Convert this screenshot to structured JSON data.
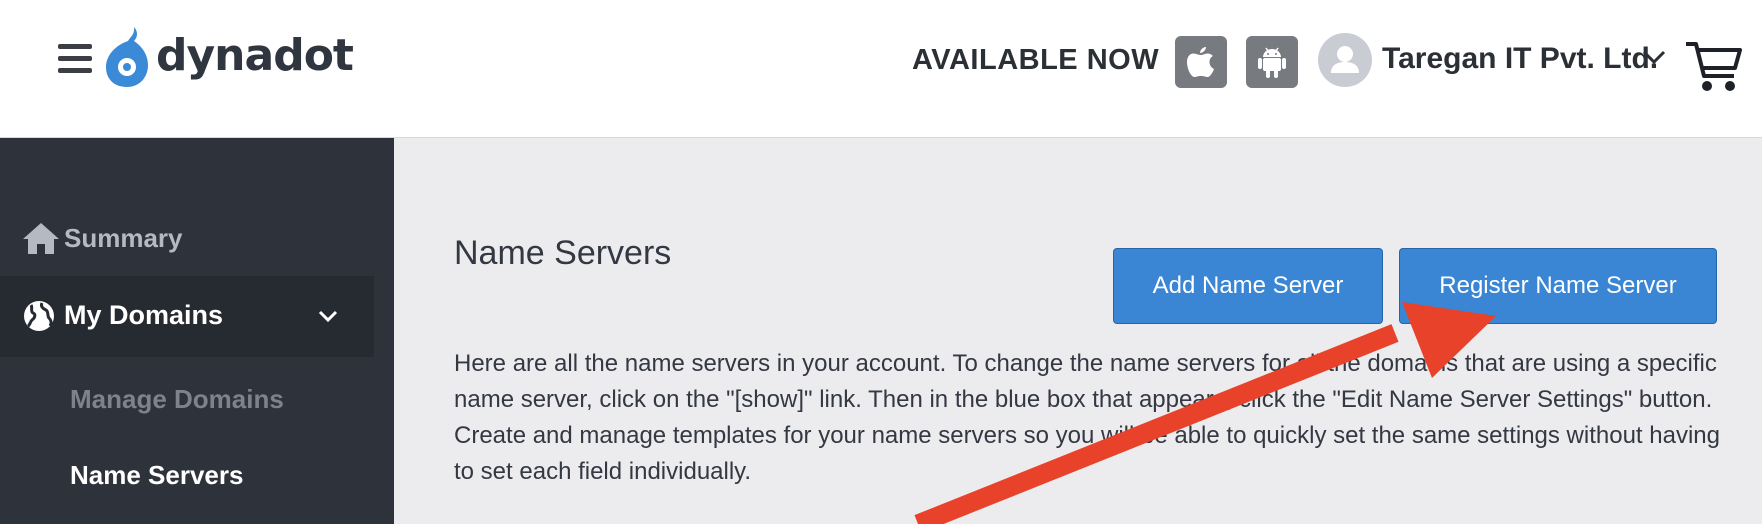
{
  "header": {
    "logo_text": "dynadot",
    "available_now": "AVAILABLE NOW",
    "apple_icon": "apple-icon",
    "android_icon": "android-icon",
    "account_name": "Taregan IT Pvt. Ltd.",
    "cart_icon": "cart-icon"
  },
  "sidebar": {
    "items": [
      {
        "label": "Summary",
        "icon": "home-icon"
      },
      {
        "label": "My Domains",
        "icon": "globe-icon",
        "expanded": true
      },
      {
        "label": "Manage Domains"
      },
      {
        "label": "Name Servers",
        "active": true
      }
    ]
  },
  "main": {
    "title": "Name Servers",
    "add_button": "Add Name Server",
    "register_button": "Register Name Server",
    "description": [
      "Here are all the name servers in your account. To change the name servers for all the domains that are using a specific name server, click on the \"[show]\" link. Then in the blue box that appears, click the \"Edit Name Server Settings\" button.",
      "Create and manage templates for your name servers so you will be able to quickly set the same settings without having to set each field individually."
    ]
  },
  "colors": {
    "sidebar_bg": "#2d323b",
    "main_bg": "#ececee",
    "button_blue": "#3a86d4",
    "logo_blue": "#3b8ad8",
    "annotation_arrow": "#e8422b"
  }
}
